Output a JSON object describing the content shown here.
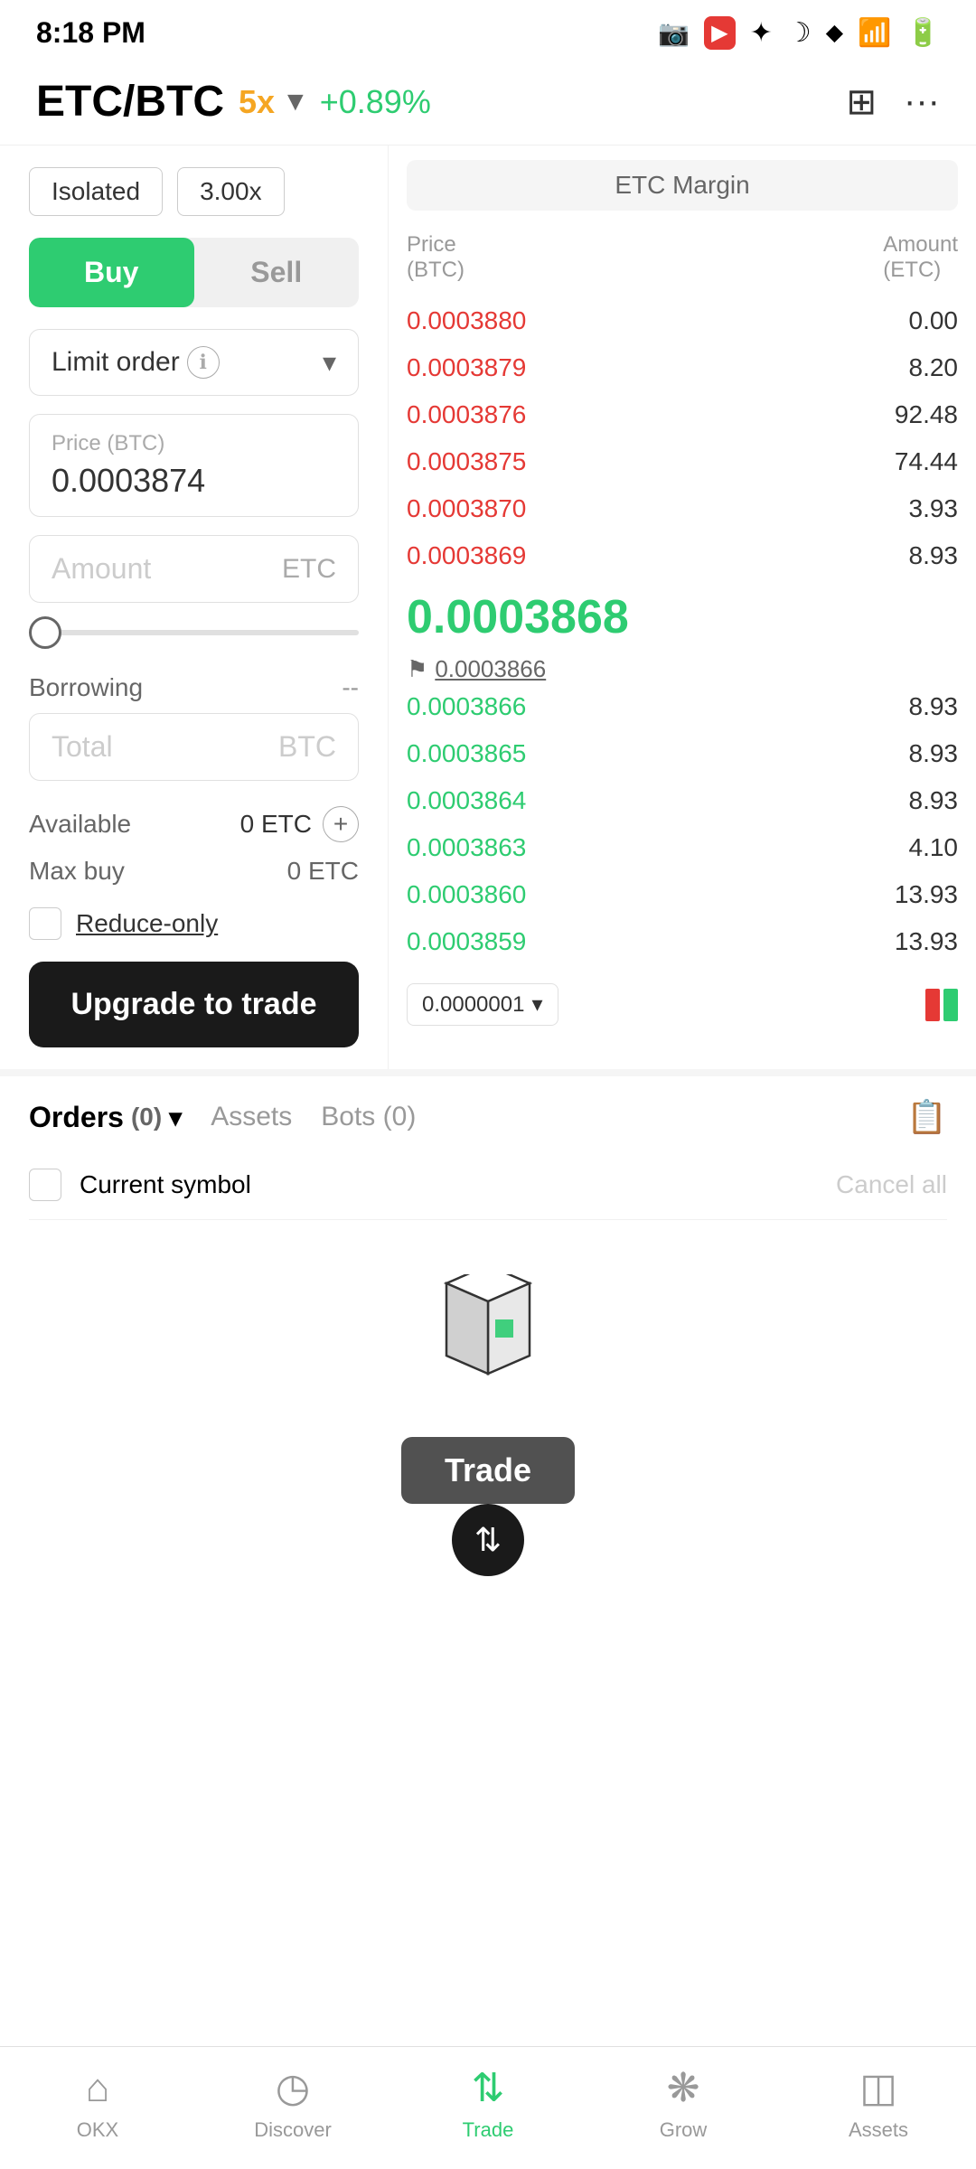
{
  "statusBar": {
    "time": "8:18 PM",
    "icons": [
      "camera",
      "bluetooth",
      "moon",
      "signal",
      "wifi",
      "battery"
    ]
  },
  "header": {
    "symbol": "ETC/BTC",
    "leverage": "5x",
    "change": "+0.89%",
    "chartIcon": "⊞",
    "moreIcon": "···"
  },
  "tradePanel": {
    "badge_isolated": "Isolated",
    "badge_leverage": "3.00x",
    "btn_buy": "Buy",
    "btn_sell": "Sell",
    "order_type": "Limit order",
    "price_label": "Price (BTC)",
    "price_value": "0.0003874",
    "amount_placeholder": "Amount",
    "amount_currency": "ETC",
    "borrowing_label": "Borrowing",
    "borrowing_value": "--",
    "total_placeholder": "Total",
    "total_currency": "BTC",
    "available_label": "Available",
    "available_value": "0 ETC",
    "maxbuy_label": "Max buy",
    "maxbuy_value": "0 ETC",
    "reduce_only_label": "Reduce-only",
    "upgrade_btn": "Upgrade to trade"
  },
  "orderbook": {
    "etc_margin": "ETC Margin",
    "col_price": "Price\n(BTC)",
    "col_amount": "Amount\n(ETC)",
    "sell_orders": [
      {
        "price": "0.0003880",
        "amount": "0.00"
      },
      {
        "price": "0.0003879",
        "amount": "8.20"
      },
      {
        "price": "0.0003876",
        "amount": "92.48"
      },
      {
        "price": "0.0003875",
        "amount": "74.44"
      },
      {
        "price": "0.0003870",
        "amount": "3.93"
      },
      {
        "price": "0.0003869",
        "amount": "8.93"
      }
    ],
    "current_price": "0.0003868",
    "flag_price": "0.0003866",
    "buy_orders": [
      {
        "price": "0.0003866",
        "amount": "8.93"
      },
      {
        "price": "0.0003865",
        "amount": "8.93"
      },
      {
        "price": "0.0003864",
        "amount": "8.93"
      },
      {
        "price": "0.0003863",
        "amount": "4.10"
      },
      {
        "price": "0.0003860",
        "amount": "13.93"
      },
      {
        "price": "0.0003859",
        "amount": "13.93"
      }
    ],
    "precision": "0.0000001",
    "precision_arrow": "▾"
  },
  "ordersSection": {
    "tab_orders": "Orders",
    "orders_count": "(0)",
    "tab_assets": "Assets",
    "tab_bots": "Bots",
    "bots_count": "(0)",
    "current_symbol_label": "Current symbol",
    "cancel_all_label": "Cancel all"
  },
  "bottomNav": {
    "items": [
      {
        "icon": "⌂",
        "label": "OKX",
        "active": false
      },
      {
        "icon": "◷",
        "label": "Discover",
        "active": false
      },
      {
        "icon": "⇅",
        "label": "Trade",
        "active": true
      },
      {
        "icon": "❋",
        "label": "Grow",
        "active": false
      },
      {
        "icon": "◫",
        "label": "Assets",
        "active": false
      }
    ],
    "trade_label": "Trade"
  },
  "sysNav": {
    "back": "‹",
    "home": "□",
    "menu": "≡"
  }
}
